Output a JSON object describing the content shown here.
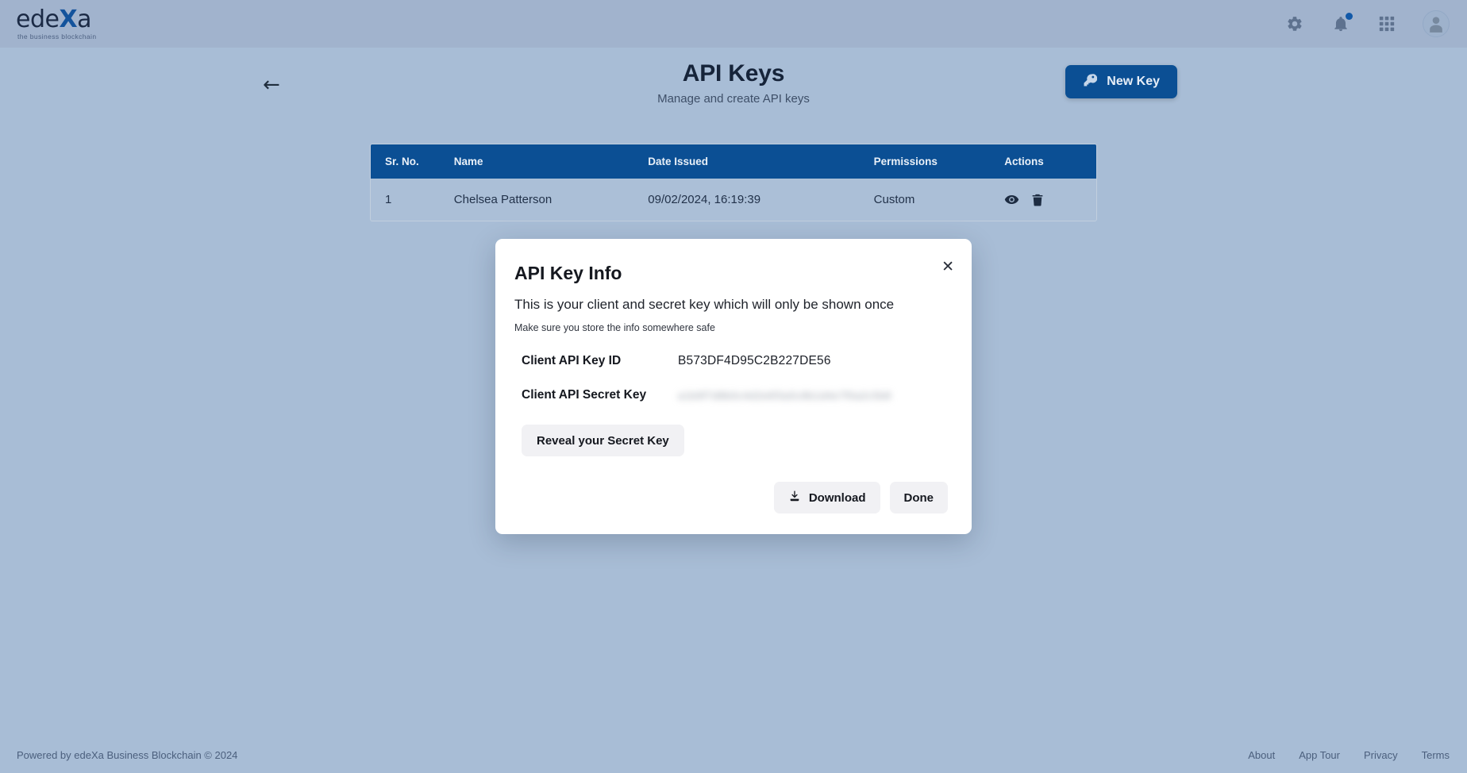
{
  "header": {
    "logo_main": "ede",
    "logo_accent": "X",
    "logo_main_tail": "a",
    "logo_tagline": "the business blockchain",
    "icons": {
      "settings": "gear-icon",
      "notifications": "bell-icon",
      "apps": "grid-apps-icon",
      "profile": "user-avatar-icon"
    }
  },
  "page": {
    "back_arrow": "←",
    "title": "API Keys",
    "subtitle": "Manage and create API keys",
    "new_key_label": "New Key"
  },
  "table": {
    "columns": [
      "Sr. No.",
      "Name",
      "Date Issued",
      "Permissions",
      "Actions"
    ],
    "rows": [
      {
        "sr_no": "1",
        "name": "Chelsea Patterson",
        "date_issued": "09/02/2024, 16:19:39",
        "permissions": "Custom"
      }
    ]
  },
  "modal": {
    "title": "API Key Info",
    "description": "This is your client and secret key which will only be shown once",
    "note": "Make sure you store the info somewhere safe",
    "close_label": "✕",
    "fields": [
      {
        "label": "Client API Key ID",
        "value": "B573DF4D95C2B227DE56",
        "masked": false
      },
      {
        "label": "Client API Secret Key",
        "value": "a1b9f7d8b0c4d2e6f3a5c8b1d4e7f0a2c5b8",
        "masked": true
      }
    ],
    "reveal_label": "Reveal your Secret Key",
    "download_label": "Download",
    "done_label": "Done"
  },
  "footer": {
    "copyright": "Powered by edeXa Business Blockchain © 2024",
    "links": [
      "About",
      "App Tour",
      "Privacy",
      "Terms"
    ]
  },
  "colors": {
    "page_bg": "#a8bdd6",
    "topbar_bg": "#a1b3cd",
    "accent_blue": "#0b4f94",
    "modal_bg": "#ffffff",
    "badge": "#1259a8"
  }
}
